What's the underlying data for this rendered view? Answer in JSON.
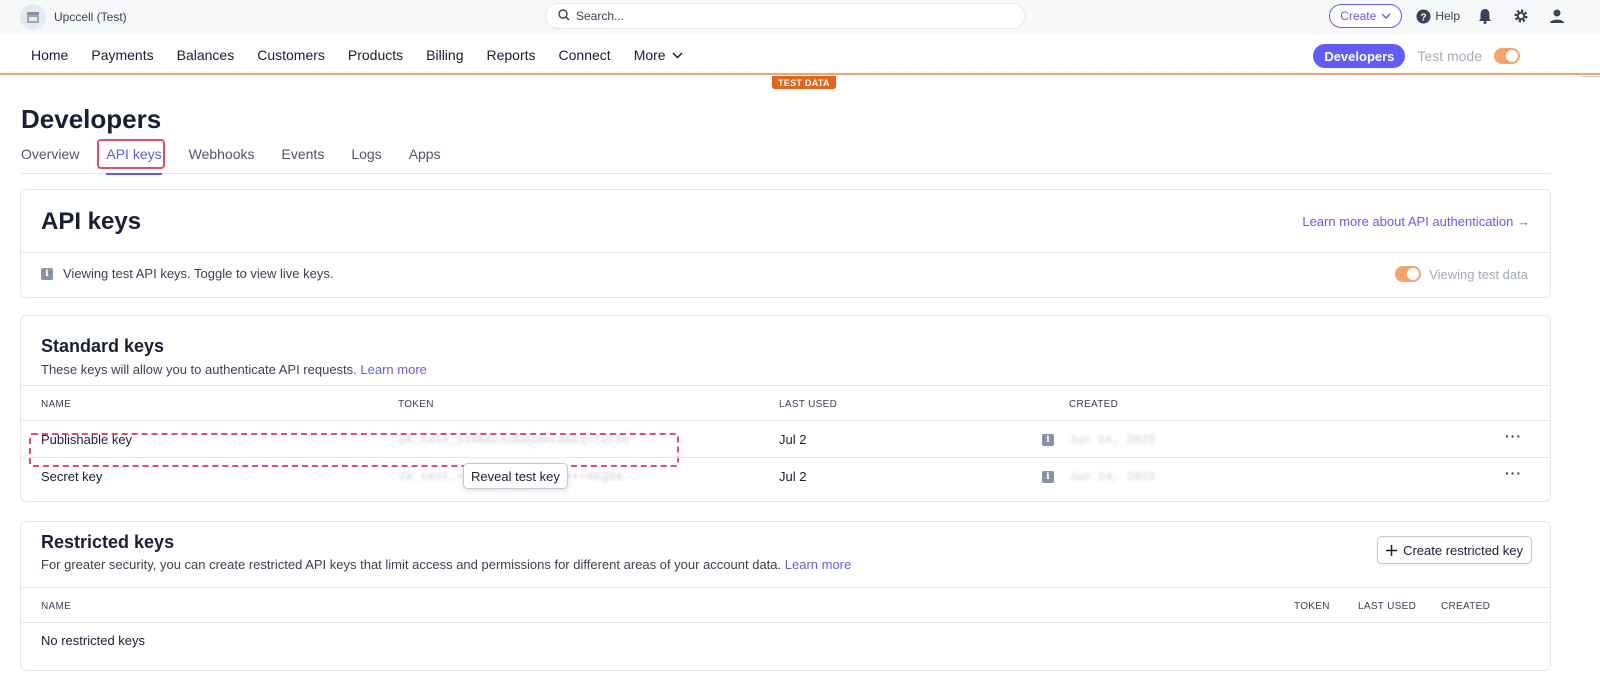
{
  "topbar": {
    "account_name": "Upccell (Test)",
    "search_placeholder": "Search...",
    "create_label": "Create",
    "help_label": "Help"
  },
  "nav": {
    "items": [
      {
        "label": "Home"
      },
      {
        "label": "Payments"
      },
      {
        "label": "Balances"
      },
      {
        "label": "Customers"
      },
      {
        "label": "Products"
      },
      {
        "label": "Billing"
      },
      {
        "label": "Reports"
      },
      {
        "label": "Connect"
      },
      {
        "label": "More"
      }
    ],
    "developers_label": "Developers",
    "test_mode_label": "Test mode",
    "test_mode_on": true,
    "test_data_badge": "TEST DATA"
  },
  "page": {
    "title": "Developers",
    "tabs": [
      {
        "label": "Overview",
        "active": false
      },
      {
        "label": "API keys",
        "active": true
      },
      {
        "label": "Webhooks",
        "active": false
      },
      {
        "label": "Events",
        "active": false
      },
      {
        "label": "Logs",
        "active": false
      },
      {
        "label": "Apps",
        "active": false
      }
    ]
  },
  "api_keys_card": {
    "title": "API keys",
    "learn_link": "Learn more about API authentication →",
    "notice": "Viewing test API keys. Toggle to view live keys.",
    "viewing_label": "Viewing test data"
  },
  "standard_keys": {
    "title": "Standard keys",
    "subtitle": "These keys will allow you to authenticate API requests.",
    "learn_more": "Learn more",
    "columns": {
      "name": "NAME",
      "token": "TOKEN",
      "last_used": "LAST USED",
      "created": "CREATED"
    },
    "rows": [
      {
        "name": "Publishable key",
        "token": "pk_test_51NbXcXsERnAkL8mZqYT2rV8",
        "last_used": "Jul 2",
        "created": "Jun 14, 2023"
      },
      {
        "name": "Secret key",
        "token": "sk_test_••••••••••••••••••4kQ9a",
        "last_used": "Jul 2",
        "created": "Jun 14, 2023"
      }
    ],
    "reveal_label": "Reveal test key"
  },
  "restricted_keys": {
    "title": "Restricted keys",
    "subtitle": "For greater security, you can create restricted API keys that limit access and permissions for different areas of your account data.",
    "learn_more": "Learn more",
    "create_label": "Create restricted key",
    "columns": {
      "name": "NAME",
      "token": "TOKEN",
      "last_used": "LAST USED",
      "created": "CREATED"
    },
    "empty_text": "No restricted keys"
  },
  "colors": {
    "accent": "#635bff",
    "test_orange": "#f5a26d",
    "badge_orange": "#e5641a",
    "highlight_red": "#e84a6a"
  }
}
